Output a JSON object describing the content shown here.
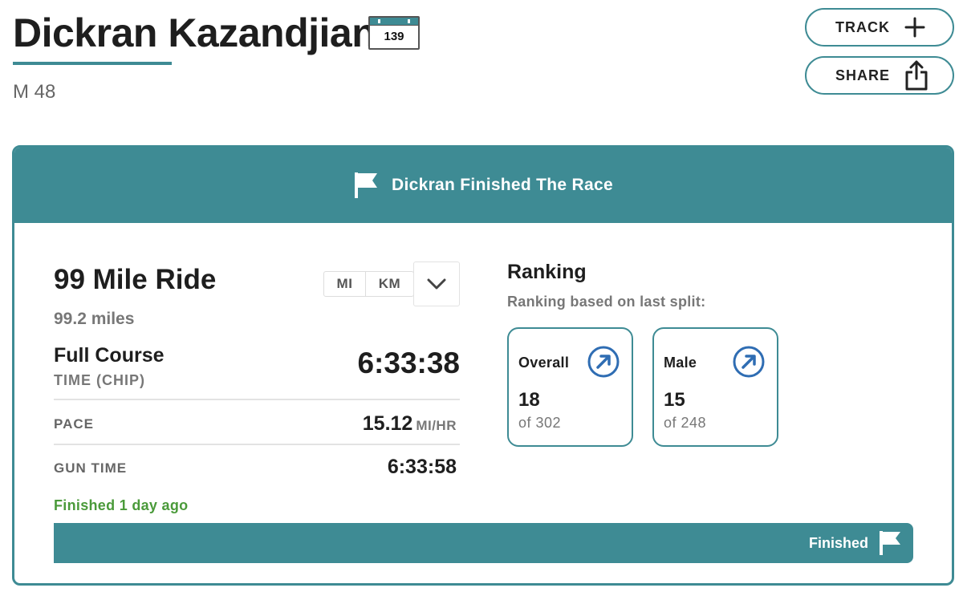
{
  "athlete": {
    "name": "Dickran Kazandjian",
    "bib_number": "139",
    "meta": "M 48"
  },
  "actions": {
    "track_label": "TRACK",
    "share_label": "SHARE"
  },
  "status_banner": {
    "text": "Dickran Finished The Race"
  },
  "race": {
    "title": "99 Mile Ride",
    "distance": "99.2 miles",
    "units": [
      "MI",
      "KM"
    ],
    "course_name": "Full Course",
    "time_label": "TIME (CHIP)",
    "chip_time": "6:33:38",
    "pace_label": "PACE",
    "pace_value": "15.12",
    "pace_unit": "MI/HR",
    "gun_time_label": "GUN TIME",
    "gun_time_value": "6:33:58",
    "finished_ago": "Finished 1 day ago"
  },
  "progress": {
    "label": "Finished",
    "fraction": 1.0
  },
  "ranking": {
    "title": "Ranking",
    "subtitle": "Ranking based on last split:",
    "boxes": [
      {
        "label": "Overall",
        "place": "18",
        "of": "of 302"
      },
      {
        "label": "Male",
        "place": "15",
        "of": "of 248"
      }
    ]
  },
  "colors": {
    "accent": "#3e8b94",
    "finished_text": "#4a9a3a",
    "rank_icon": "#2f6db3"
  },
  "icons": {
    "bib": "calendar-bib-icon",
    "track": "plus-icon",
    "share": "share-icon",
    "banner": "flag-icon",
    "dropdown": "chevron-down-icon",
    "rank": "arrow-up-right-circle-icon",
    "progress": "flag-icon"
  }
}
